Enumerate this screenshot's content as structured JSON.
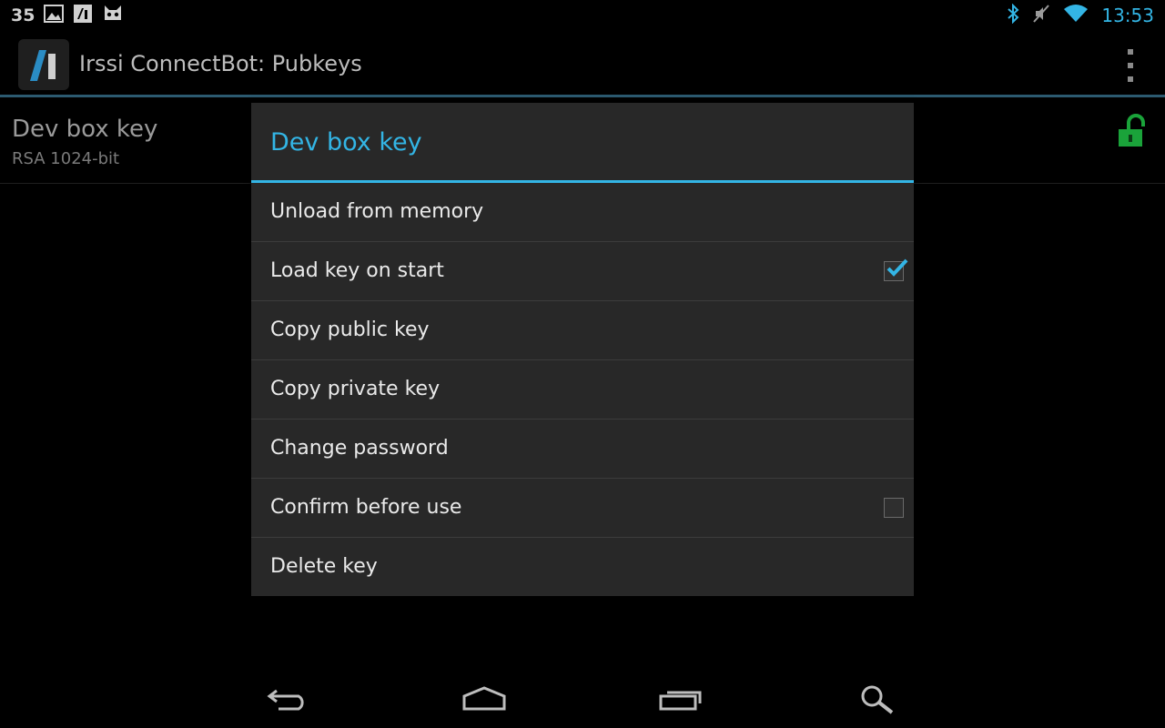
{
  "status_bar": {
    "notification_count": "35",
    "time": "13:53"
  },
  "action_bar": {
    "title": "Irssi ConnectBot: Pubkeys"
  },
  "key_list": [
    {
      "name": "Dev box key",
      "type": "RSA 1024-bit"
    }
  ],
  "dialog": {
    "title": "Dev box key",
    "items": [
      {
        "label": "Unload from memory",
        "checkbox": null
      },
      {
        "label": "Load key on start",
        "checkbox": true
      },
      {
        "label": "Copy public key",
        "checkbox": null
      },
      {
        "label": "Copy private key",
        "checkbox": null
      },
      {
        "label": "Change password",
        "checkbox": null
      },
      {
        "label": "Confirm before use",
        "checkbox": false
      },
      {
        "label": "Delete key",
        "checkbox": null
      }
    ]
  },
  "colors": {
    "accent": "#33b5e5",
    "lock_green": "#1aa33a",
    "dialog_bg": "#282828"
  },
  "icons": {
    "status": [
      "picture-icon",
      "connectbot-icon",
      "cyanogenmod-icon",
      "bluetooth-icon",
      "mute-icon",
      "wifi-icon"
    ],
    "nav": [
      "back-icon",
      "home-icon",
      "recent-apps-icon",
      "search-icon"
    ]
  }
}
